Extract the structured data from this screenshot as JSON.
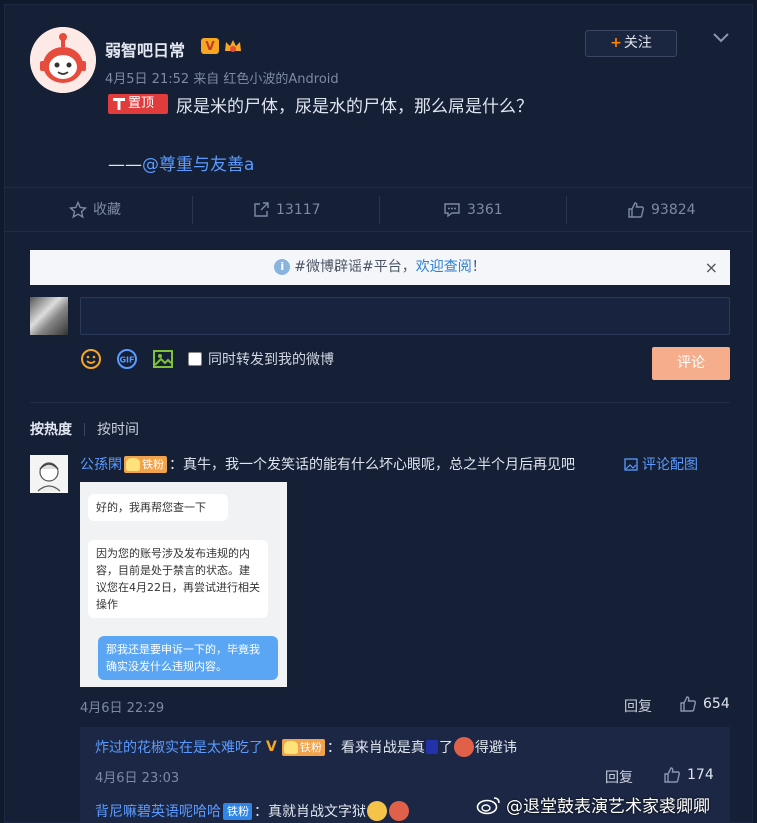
{
  "post": {
    "username": "弱智吧日常",
    "follow_label": "关注",
    "meta": "4月5日 21:52 来自 红色小波的Android",
    "pin_label": "置顶",
    "content": "尿是米的尸体，尿是水的尸体，那么屌是什么？",
    "signature_prefix": "——",
    "signature_mention": "@尊重与友善a"
  },
  "actions": {
    "favorite": "收藏",
    "repost": "13117",
    "comment": "3361",
    "like": "93824"
  },
  "notice": {
    "text": "#微博辟谣#平台，",
    "link": "欢迎查阅",
    "tail": "！",
    "close": "×"
  },
  "composer": {
    "repost_checkbox_label": "同时转发到我的微博",
    "submit_label": "评论"
  },
  "sort": {
    "hot": "按热度",
    "time": "按时间"
  },
  "comment": {
    "name": "公孫閑",
    "fan_badge": "铁粉",
    "text": "：真牛，我一个发笑话的能有什么坏心眼呢，总之半个月后再见吧",
    "pic_link": "评论配图",
    "time": "4月6日 22:29",
    "reply": "回复",
    "likes": "654",
    "screenshot": {
      "bubble1": "好的，我再帮您查一下",
      "bubble2": "因为您的账号涉及发布违规的内容，目前是处于禁言的状态。建议您在4月22日，再尝试进行相关操作",
      "bubble3": "那我还是要申诉一下的，毕竟我确实没发什么违规内容。"
    }
  },
  "subcomments": [
    {
      "name": "炸过的花椒实在是太难吃了",
      "fan_badge": "铁粉",
      "text_a": "：看来肖战是真",
      "text_b": "了",
      "text_c": "得避讳",
      "time": "4月6日 23:03",
      "reply": "回复",
      "likes": "174"
    },
    {
      "name": "背尼嘛碧英语呢哈哈",
      "fan_badge": "铁粉",
      "text": "：真就肖战文字狱"
    }
  ],
  "watermark": "@退堂鼓表演艺术家裘卿卿",
  "colors": {
    "background": "#151f35",
    "accent_link": "#5b9bff",
    "brand_orange": "#ff8200",
    "pin_red": "#e03c3c"
  }
}
